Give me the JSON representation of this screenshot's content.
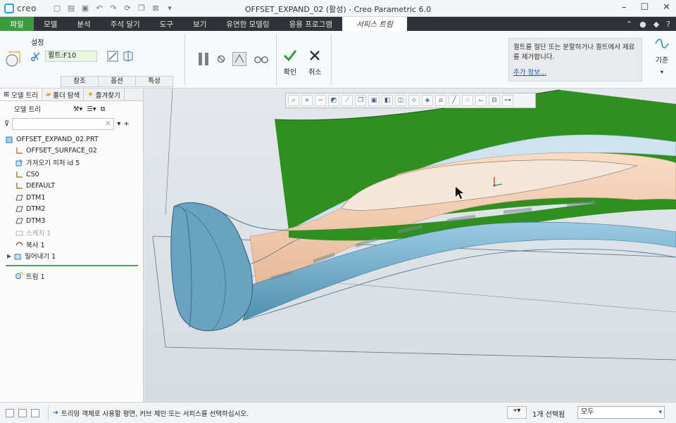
{
  "window": {
    "logo": "creo",
    "title": "OFFSET_EXPAND_02 (활성) - Creo Parametric 6.0"
  },
  "ribbon_tabs": [
    "파일",
    "모델",
    "분석",
    "주석 달기",
    "도구",
    "보기",
    "유연한 모델링",
    "응용 프로그램",
    "서피스 트림"
  ],
  "ribbon": {
    "settings_label": "설정",
    "feature_field": "퀼트:F10",
    "sub_tabs": [
      "참조",
      "옵션",
      "특성"
    ],
    "ok_label": "확인",
    "cancel_label": "취소",
    "help_text": "퀼트를 절단 또는 분할하거나 퀼트에서 재료를 제거합니다.",
    "help_link": "추가 정보...",
    "datum_label": "기준"
  },
  "left_panel": {
    "tabs": [
      "모델 트리",
      "폴더 탐색",
      "즐겨찾기"
    ],
    "toolbar_label": "모델 트리",
    "tree": [
      {
        "label": "OFFSET_EXPAND_02.PRT",
        "icon": "part-icon",
        "dim": false
      },
      {
        "label": "OFFSET_SURFACE_02",
        "icon": "csys-icon",
        "dim": false
      },
      {
        "label": "가져오기 피처 id 5",
        "icon": "import-icon",
        "dim": false
      },
      {
        "label": "CS0",
        "icon": "csys-icon",
        "dim": false
      },
      {
        "label": "DEFAULT",
        "icon": "csys-icon",
        "dim": false
      },
      {
        "label": "DTM1",
        "icon": "datum-plane-icon",
        "dim": false
      },
      {
        "label": "DTM2",
        "icon": "datum-plane-icon",
        "dim": false
      },
      {
        "label": "DTM3",
        "icon": "datum-plane-icon",
        "dim": false
      },
      {
        "label": "스케치 1",
        "icon": "sketch-icon",
        "dim": true
      },
      {
        "label": "복사 1",
        "icon": "copy-icon",
        "dim": false
      },
      {
        "label": "밀어내기 1",
        "icon": "extrude-icon",
        "dim": false
      }
    ],
    "insert_item": "트림 1"
  },
  "statusbar": {
    "message": "트리밍 객체로 사용할 평면, 커브 체인 또는 서피스를 선택하십시오.",
    "selection": "1개 선택됨",
    "filter": "모두"
  },
  "colors": {
    "file_tab": "#3a9a3e",
    "ribbon_dark": "#2f3338",
    "quilt_green": "#2f8f1f",
    "part_blue": "#6fa8c4",
    "surface_peach": "#f0c6a8"
  }
}
